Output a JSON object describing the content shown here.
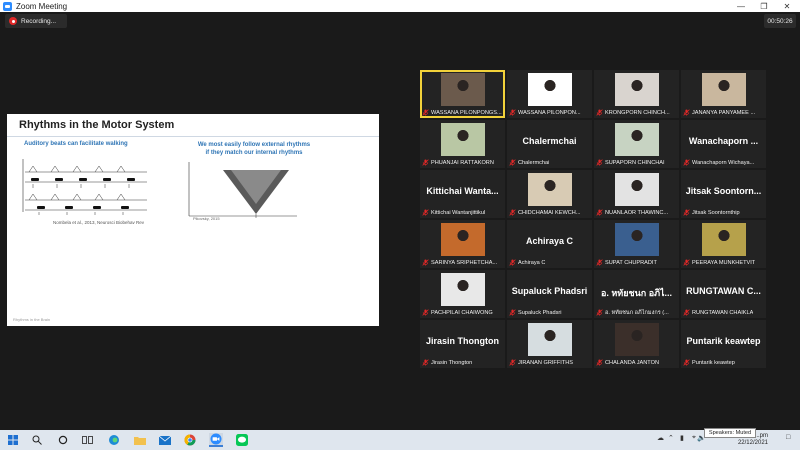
{
  "window": {
    "title": "Zoom Meeting"
  },
  "recording": {
    "label": "Recording..."
  },
  "timer": "00:50:26",
  "slide": {
    "title": "Rhythms in the Motor System",
    "left_heading": "Auditory beats can facilitate walking",
    "right_heading_line1": "We most easily follow external rhythms",
    "right_heading_line2": "if they match our internal rhythms",
    "left_citation": "Nombela et al., 2013, Neurosci Biobehav Rev",
    "right_citation": "Pikovsky, 2015",
    "footer": "Rhythms in the Brain"
  },
  "participants": [
    {
      "type": "video",
      "caption": "WASSANA PILONPONGS...",
      "active": true,
      "bg": "#6b5a4c"
    },
    {
      "type": "video",
      "caption": "WASSANA PILONPON...",
      "bg": "#ffffff"
    },
    {
      "type": "video",
      "caption": "KRONGPORN CHINCH...",
      "bg": "#d9d4cf"
    },
    {
      "type": "video",
      "caption": "JANANYA PANYAMEE ...",
      "bg": "#c9b79e"
    },
    {
      "type": "video",
      "caption": "PHUANJAI RATTAKORN",
      "bg": "#b9c7a4"
    },
    {
      "type": "name",
      "name": "Chalermchai",
      "caption": "Chalermchai"
    },
    {
      "type": "video",
      "caption": "SUPAPORN CHINCHAI",
      "bg": "#c7d3c2"
    },
    {
      "type": "name",
      "name": "Wanachaporn ...",
      "caption": "Wanachaporn Wichaya..."
    },
    {
      "type": "name",
      "name": "Kittichai  Wanta...",
      "caption": "Kittichai Wantanjittikul"
    },
    {
      "type": "video",
      "caption": "CHIDCHAMAI KEWCH...",
      "bg": "#d8cbb4"
    },
    {
      "type": "video",
      "caption": "NUANLAOR THAWINC...",
      "bg": "#e3e3e3"
    },
    {
      "type": "name",
      "name": "Jitsak  Soontorn...",
      "caption": "Jitsak Soontornthip"
    },
    {
      "type": "video",
      "caption": "SARINYA SRIPHETCHA...",
      "bg": "#c46a2c"
    },
    {
      "type": "name",
      "name": "Achiraya C",
      "caption": "Achiraya C"
    },
    {
      "type": "video",
      "caption": "SUPAT CHUPRADIT",
      "bg": "#3a5f8f"
    },
    {
      "type": "video",
      "caption": "PEERAYA MUNKHETVIT",
      "bg": "#b6a14b"
    },
    {
      "type": "video",
      "caption": "PACHPILAI CHAIWONG",
      "bg": "#e8e8e8"
    },
    {
      "type": "name",
      "name": "Supaluck  Phadsri",
      "caption": "Supaluck Phadsri"
    },
    {
      "type": "name",
      "name": "อ. หทัยชนก  อภิไ...",
      "caption": "อ. หทัยชนก อภิไกมงกร (..."
    },
    {
      "type": "name",
      "name": "RUNGTAWAN  C...",
      "caption": "RUNGTAWAN CHAIKLA"
    },
    {
      "type": "name",
      "name": "Jirasin Thongton",
      "caption": "Jirasin Thongton"
    },
    {
      "type": "video",
      "caption": "JIRANAN GRIFFITHS",
      "bg": "#d6dde0"
    },
    {
      "type": "video",
      "caption": "CHALANDA JANTON",
      "bg": "#3b2f2a"
    },
    {
      "type": "name",
      "name": "Puntarik keawtep",
      "caption": "Puntarik keawtep"
    }
  ],
  "taskbar": {
    "tooltip": "Speakers: Muted",
    "time": "...pm",
    "date": "22/12/2021"
  },
  "colors": {
    "active_speaker": "#f2d23a",
    "muted_mic": "#e02828",
    "slide_heading": "#2f75b5"
  }
}
